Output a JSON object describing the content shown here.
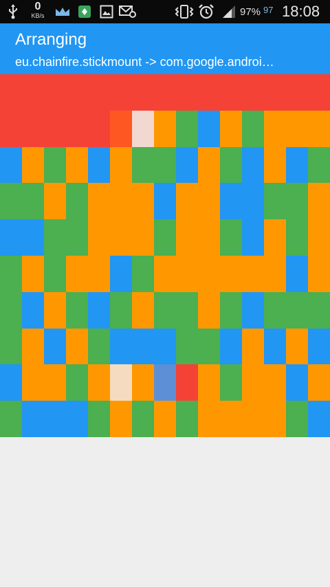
{
  "status_bar": {
    "net_speed_value": "0",
    "net_speed_unit": "KB/s",
    "battery_percent": "97%",
    "battery_level": "97",
    "time": "18:08",
    "icons": [
      "usb-icon",
      "crown-icon",
      "app-notification-icon",
      "image-icon",
      "mail-settings-icon",
      "vibrate-icon",
      "alarm-icon",
      "signal-icon",
      "battery-icon"
    ]
  },
  "app_bar": {
    "title": "Arranging",
    "subtitle": "eu.chainfire.stickmount -> com.google.androi…"
  },
  "colors": {
    "red": "#f44336",
    "orange": "#ff9800",
    "green": "#4caf50",
    "blue": "#2196f3",
    "deep_orange": "#ff5722",
    "light_pink": "#f2d8d0",
    "light_peach": "#f5dcc0",
    "steel_blue": "#5c8fd6",
    "accent": "#2196f3",
    "background": "#eeeeee"
  },
  "grid": {
    "columns": 15,
    "rows": 10,
    "cells": [
      "RRRRRRRRRRRRRRR",
      "RRRRRDPOGBOGOOO",
      "BOGOBOGGBOGBOBG",
      "GGOGOOOBOOBBGGO",
      "BBGGOOOGOOGBOGO",
      "GOGOOBGOOOOOOBO",
      "GBOGBGOGGOGBGGG",
      "GOBOGBBBGGBOBOB",
      "BOOGOEOSROGOOBO",
      "GBBBGOGOGOOOOGB"
    ]
  }
}
